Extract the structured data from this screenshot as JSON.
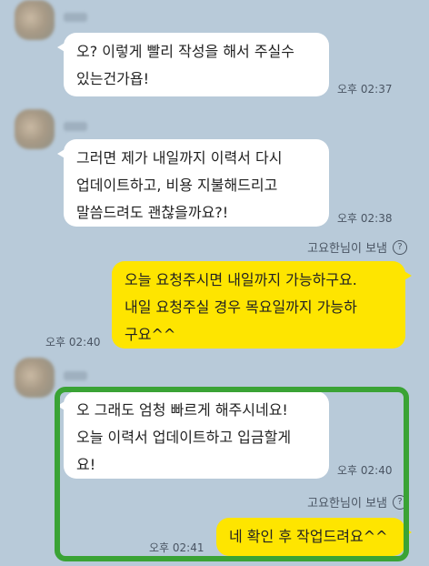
{
  "messages": [
    {
      "type": "in",
      "text": "오? 이렇게 빨리 작성을 해서 주실수\n있는건가욥!",
      "time": "오후 02:37"
    },
    {
      "type": "in",
      "text": "그러면 제가 내일까지 이력서 다시\n업데이트하고, 비용 지불해드리고\n말씀드려도 괜찮을까요?!",
      "time": "오후 02:38"
    },
    {
      "type": "note",
      "text": "고요한님이 보냄"
    },
    {
      "type": "out",
      "text": "오늘 요청주시면 내일까지 가능하구요.\n내일 요청주실 경우 목요일까지 가능하\n구요^^",
      "time": "오후 02:40"
    },
    {
      "type": "in",
      "text": "오 그래도 엄청 빠르게 해주시네요!\n오늘 이력서 업데이트하고 입금할게\n요!",
      "time": "오후 02:40"
    },
    {
      "type": "note",
      "text": "고요한님이 보냄"
    },
    {
      "type": "out",
      "text": "네 확인 후 작업드려요^^",
      "time": "오후 02:41"
    }
  ],
  "icons": {
    "help": "question-circle-icon",
    "help_glyph": "?"
  },
  "colors": {
    "background": "#b8cad9",
    "incoming": "#ffffff",
    "outgoing": "#fee500",
    "highlight": "#3aa335"
  }
}
